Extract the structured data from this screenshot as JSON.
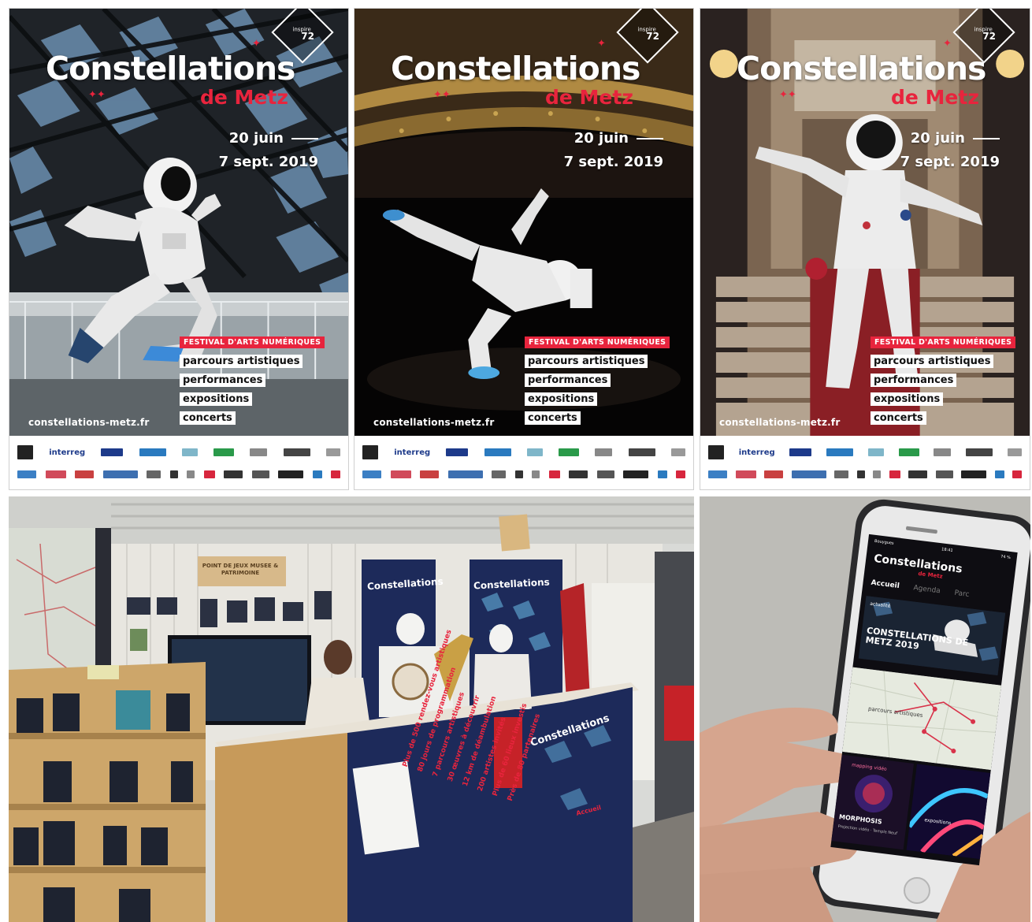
{
  "posters": [
    {
      "title": "Constellations",
      "subtitle": "de Metz",
      "dates_line1": "20 juin",
      "dates_line2": "7 sept. 2019",
      "festival_label": "FESTIVAL D'ARTS NUMÉRIQUES",
      "tags": [
        "parcours artistiques",
        "performances",
        "expositions",
        "concerts"
      ],
      "website": "constellations-metz.fr",
      "partner_interreg": "interreg",
      "corner_badge": "inspire",
      "corner_badge_mark": "72"
    },
    {
      "title": "Constellations",
      "subtitle": "de Metz",
      "dates_line1": "20 juin",
      "dates_line2": "7 sept. 2019",
      "festival_label": "FESTIVAL D'ARTS NUMÉRIQUES",
      "tags": [
        "parcours artistiques",
        "performances",
        "expositions",
        "concerts"
      ],
      "website": "constellations-metz.fr",
      "partner_interreg": "interreg",
      "corner_badge": "inspire",
      "corner_badge_mark": "72"
    },
    {
      "title": "Constellations",
      "subtitle": "de Metz",
      "dates_line1": "20 juin",
      "dates_line2": "7 sept. 2019",
      "festival_label": "FESTIVAL D'ARTS NUMÉRIQUES",
      "tags": [
        "parcours artistiques",
        "performances",
        "expositions",
        "concerts"
      ],
      "website": "constellations-metz.fr",
      "partner_interreg": "interreg",
      "corner_badge": "inspire",
      "corner_badge_mark": "72"
    }
  ],
  "booth": {
    "sign_text": "POINT DE JEUX MUSEE & PATRIMOINE",
    "banner_left_title": "Constellations",
    "banner_right_title": "Constellations",
    "counter_title": "Constellations",
    "counter_accueil": "Accueil",
    "facts": [
      "Plus de 500 rendez-vous artistiques",
      "80 jours de programmation",
      "7 parcours artistiques",
      "30 œuvres à découvrir",
      "12 km de déambulation",
      "200 artistes invités",
      "Plus de 60 lieux investis",
      "Près de 80 partenaires"
    ]
  },
  "phone": {
    "status_left": "Bouygues",
    "status_center": "18:41",
    "status_right": "74 %",
    "app_logo": "Constellations",
    "app_logo_sub": "de Metz",
    "nav": [
      "Accueil",
      "Agenda",
      "Parc"
    ],
    "hero_label": "actualité",
    "hero_title": "CONSTELLATIONS DE METZ 2019",
    "map_label": "parcours artistiques",
    "card1_top": "mapping vidéo",
    "card1_title": "MORPHOSIS",
    "card1_sub": "Projection vidéo · Temple Neuf",
    "card2_title": "expositions"
  },
  "colors": {
    "accent_red": "#e8243d",
    "navy": "#1d2a5a",
    "white": "#ffffff"
  }
}
